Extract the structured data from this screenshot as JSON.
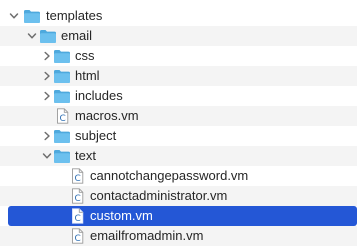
{
  "tree": {
    "rows": [
      {
        "label": "templates",
        "type": "folder",
        "expanded": true
      },
      {
        "label": "email",
        "type": "folder",
        "expanded": true
      },
      {
        "label": "css",
        "type": "folder",
        "expanded": false
      },
      {
        "label": "html",
        "type": "folder",
        "expanded": false
      },
      {
        "label": "includes",
        "type": "folder",
        "expanded": false
      },
      {
        "label": "macros.vm",
        "type": "file",
        "icon": "velocity-file-icon"
      },
      {
        "label": "subject",
        "type": "folder",
        "expanded": false
      },
      {
        "label": "text",
        "type": "folder",
        "expanded": true
      },
      {
        "label": "cannotchangepassword.vm",
        "type": "file",
        "icon": "velocity-file-icon"
      },
      {
        "label": "contactadministrator.vm",
        "type": "file",
        "icon": "velocity-file-icon"
      },
      {
        "label": "custom.vm",
        "type": "file",
        "icon": "velocity-file-icon",
        "selected": true
      },
      {
        "label": "emailfromadmin.vm",
        "type": "file",
        "icon": "velocity-file-icon"
      }
    ]
  },
  "colors": {
    "folder": "#6cc0ee",
    "folder_tab": "#4ea9dd",
    "selection": "#2457d6",
    "alternate_row": "#f4f4f4",
    "chevron": "#6e6e6e"
  }
}
